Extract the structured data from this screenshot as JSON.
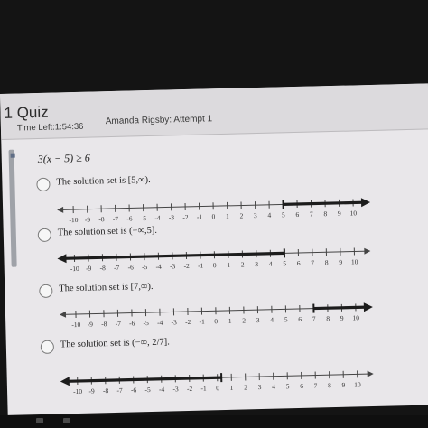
{
  "quiz": {
    "title": "1 Quiz",
    "time_left": "Time Left:1:54:36",
    "attempt": "Amanda Rigsby: Attempt 1"
  },
  "question": {
    "text": "3(x − 5) ≥ 6"
  },
  "options": [
    {
      "text": "The solution set is [5,∞).",
      "direction": "right",
      "boundary": 5,
      "closed": true
    },
    {
      "text": "The solution set is (−∞,5].",
      "direction": "left",
      "boundary": 5,
      "closed": true
    },
    {
      "text": "The solution set is [7,∞).",
      "direction": "right",
      "boundary": 7,
      "closed": true
    },
    {
      "text": "The solution set is (−∞, 2/7].",
      "direction": "left",
      "boundary": 0.2857,
      "closed": true
    }
  ],
  "number_line": {
    "min": -10,
    "max": 10,
    "ticks": [
      -10,
      -9,
      -8,
      -7,
      -6,
      -5,
      -4,
      -3,
      -2,
      -1,
      0,
      1,
      2,
      3,
      4,
      5,
      6,
      7,
      8,
      9,
      10
    ]
  },
  "colors": {
    "ink": "#1c1c1c",
    "screen": "#e9e7ea",
    "header": "#dcdadd"
  }
}
